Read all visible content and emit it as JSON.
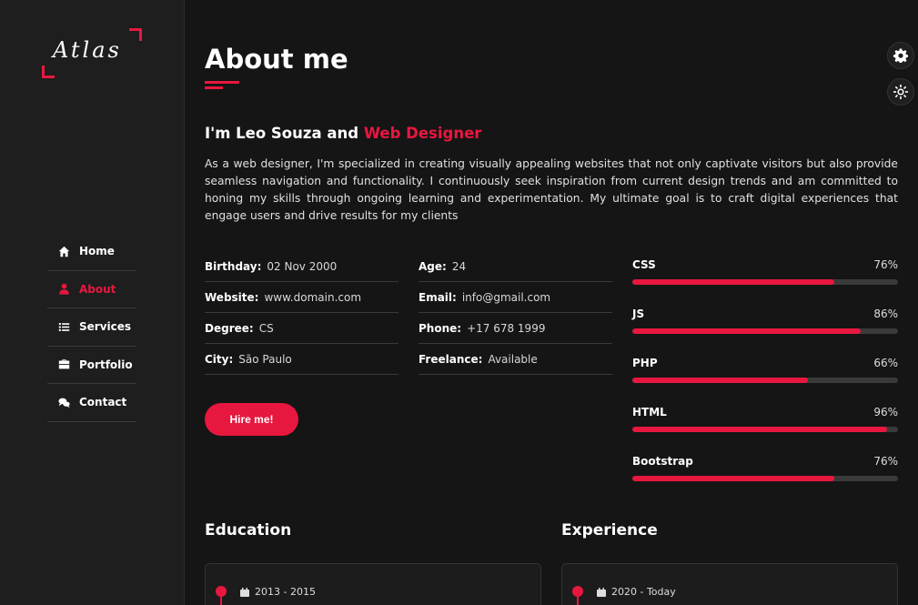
{
  "brand": {
    "logo_text": "Atlas",
    "accent_color": "#e8173f"
  },
  "nav": {
    "items": [
      {
        "label": "Home",
        "icon": "home-icon",
        "active": false
      },
      {
        "label": "About",
        "icon": "user-icon",
        "active": true
      },
      {
        "label": "Services",
        "icon": "list-icon",
        "active": false
      },
      {
        "label": "Portfolio",
        "icon": "briefcase-icon",
        "active": false
      },
      {
        "label": "Contact",
        "icon": "chat-icon",
        "active": false
      }
    ]
  },
  "about": {
    "title": "About me",
    "headline_prefix": "I'm Leo Souza and",
    "headline_accent": "Web Designer",
    "bio": "As a web designer, I'm specialized in creating visually appealing websites that not only captivate visitors but also provide seamless navigation and functionality. I continuously seek inspiration from current design trends and am committed to honing my skills through ongoing learning and experimentation. My ultimate goal is to craft digital experiences that engage users and drive results for my clients",
    "info_left": [
      {
        "key": "Birthday:",
        "value": "02 Nov 2000"
      },
      {
        "key": "Website:",
        "value": "www.domain.com"
      },
      {
        "key": "Degree:",
        "value": "CS"
      },
      {
        "key": "City:",
        "value": "São Paulo"
      }
    ],
    "info_right": [
      {
        "key": "Age:",
        "value": "24"
      },
      {
        "key": "Email:",
        "value": "info@gmail.com"
      },
      {
        "key": "Phone:",
        "value": "+17 678 1999"
      },
      {
        "key": "Freelance:",
        "value": "Available"
      }
    ],
    "hire_label": "Hire me!"
  },
  "skills": [
    {
      "name": "CSS",
      "percent_label": "76%",
      "value": 76
    },
    {
      "name": "JS",
      "percent_label": "86%",
      "value": 86
    },
    {
      "name": "PHP",
      "percent_label": "66%",
      "value": 66
    },
    {
      "name": "HTML",
      "percent_label": "96%",
      "value": 96
    },
    {
      "name": "Bootstrap",
      "percent_label": "76%",
      "value": 76
    }
  ],
  "education": {
    "title": "Education",
    "first_date": "2013 - 2015"
  },
  "experience": {
    "title": "Experience",
    "first_date": "2020 - Today"
  },
  "side_buttons": {
    "settings_icon": "gear-icon",
    "theme_icon": "sun-icon"
  }
}
